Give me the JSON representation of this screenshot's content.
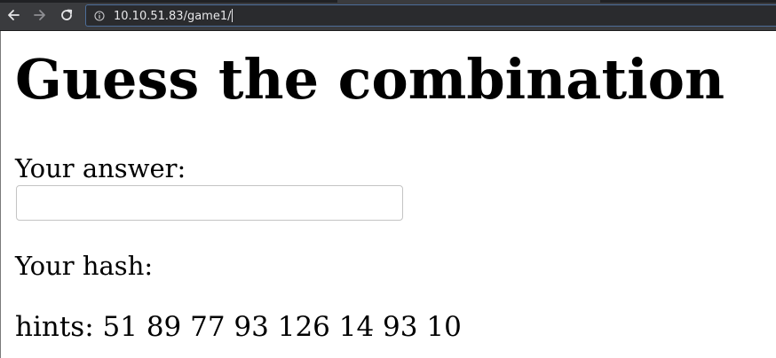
{
  "browser": {
    "url": "10.10.51.83/game1/"
  },
  "page": {
    "title": "Guess the combination",
    "answer_label": "Your answer:",
    "answer_value": "",
    "hash_label": "Your hash:",
    "hints_label": "hints:",
    "hints_values": "51 89 77 93 126 14 93 10"
  },
  "colors": {
    "toolbar_bg": "#3a3b3e",
    "address_bg": "#2a2b2e",
    "address_border": "#4d6d99",
    "page_bg": "#ffffff",
    "text": "#000000"
  },
  "icons": [
    "back-arrow-icon",
    "forward-arrow-icon",
    "reload-icon",
    "info-icon"
  ]
}
